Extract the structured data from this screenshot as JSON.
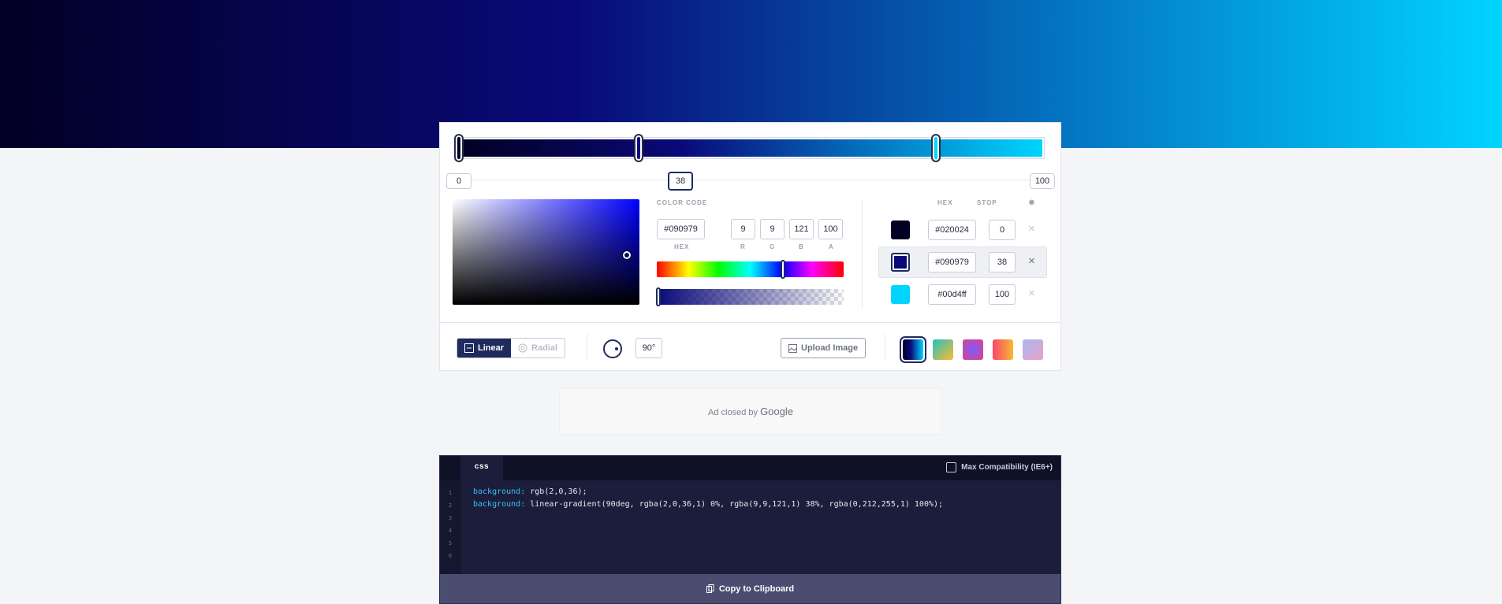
{
  "gradient": {
    "stops": [
      {
        "hex": "#020024",
        "stop": "0"
      },
      {
        "hex": "#090979",
        "stop": "38"
      },
      {
        "hex": "#00d4ff",
        "stop": "100"
      }
    ],
    "stop_labels": [
      "0",
      "38",
      "100"
    ],
    "active_stop": 1
  },
  "picker": {
    "color_code_label": "COLOR CODE",
    "hex_value": "#090979",
    "r": "9",
    "g": "9",
    "b": "121",
    "a": "100",
    "hex_caption": "HEX",
    "r_caption": "R",
    "g_caption": "G",
    "b_caption": "B",
    "a_caption": "A"
  },
  "stops_table": {
    "hex_header": "HEX",
    "stop_header": "STOP",
    "rows": [
      {
        "hex": "#020024",
        "stop": "0",
        "color": "#020024"
      },
      {
        "hex": "#090979",
        "stop": "38",
        "color": "#090979"
      },
      {
        "hex": "#00d4ff",
        "stop": "100",
        "color": "#00d4ff"
      }
    ],
    "remove_icon": "×"
  },
  "controls": {
    "linear_label": "Linear",
    "radial_label": "Radial",
    "angle": "90°",
    "upload_label": "Upload Image",
    "presets": [
      {
        "name": "current",
        "colors": [
          "#020024",
          "#090979",
          "#00d4ff"
        ]
      },
      {
        "name": "green-yellow",
        "colors": [
          "#22c1c3",
          "#fdbb2d"
        ]
      },
      {
        "name": "purple-pink",
        "colors": [
          "#833ab4",
          "#fd1d1d"
        ]
      },
      {
        "name": "red-orange",
        "colors": [
          "#fc466b",
          "#f7b733"
        ]
      },
      {
        "name": "lavender-pink",
        "colors": [
          "#a8b8f0",
          "#e8a0c8"
        ]
      }
    ]
  },
  "ad": {
    "prefix": "Ad closed by",
    "brand": "Google"
  },
  "code": {
    "tab_label": "css",
    "compat_label": "Max Compatibility (IE6+)",
    "line_numbers": [
      "1",
      "2",
      "3",
      "4",
      "5",
      "6"
    ],
    "lines": [
      {
        "prop": "background:",
        "value": " rgb(2,0,36);"
      },
      {
        "prop": "background:",
        "value": " linear-gradient(90deg, rgba(2,0,36,1) 0%, rgba(9,9,121,1) 38%, rgba(0,212,255,1) 100%);"
      }
    ],
    "copy_label": "Copy to Clipboard"
  },
  "colors": {
    "accent": "#1f2a5e"
  }
}
